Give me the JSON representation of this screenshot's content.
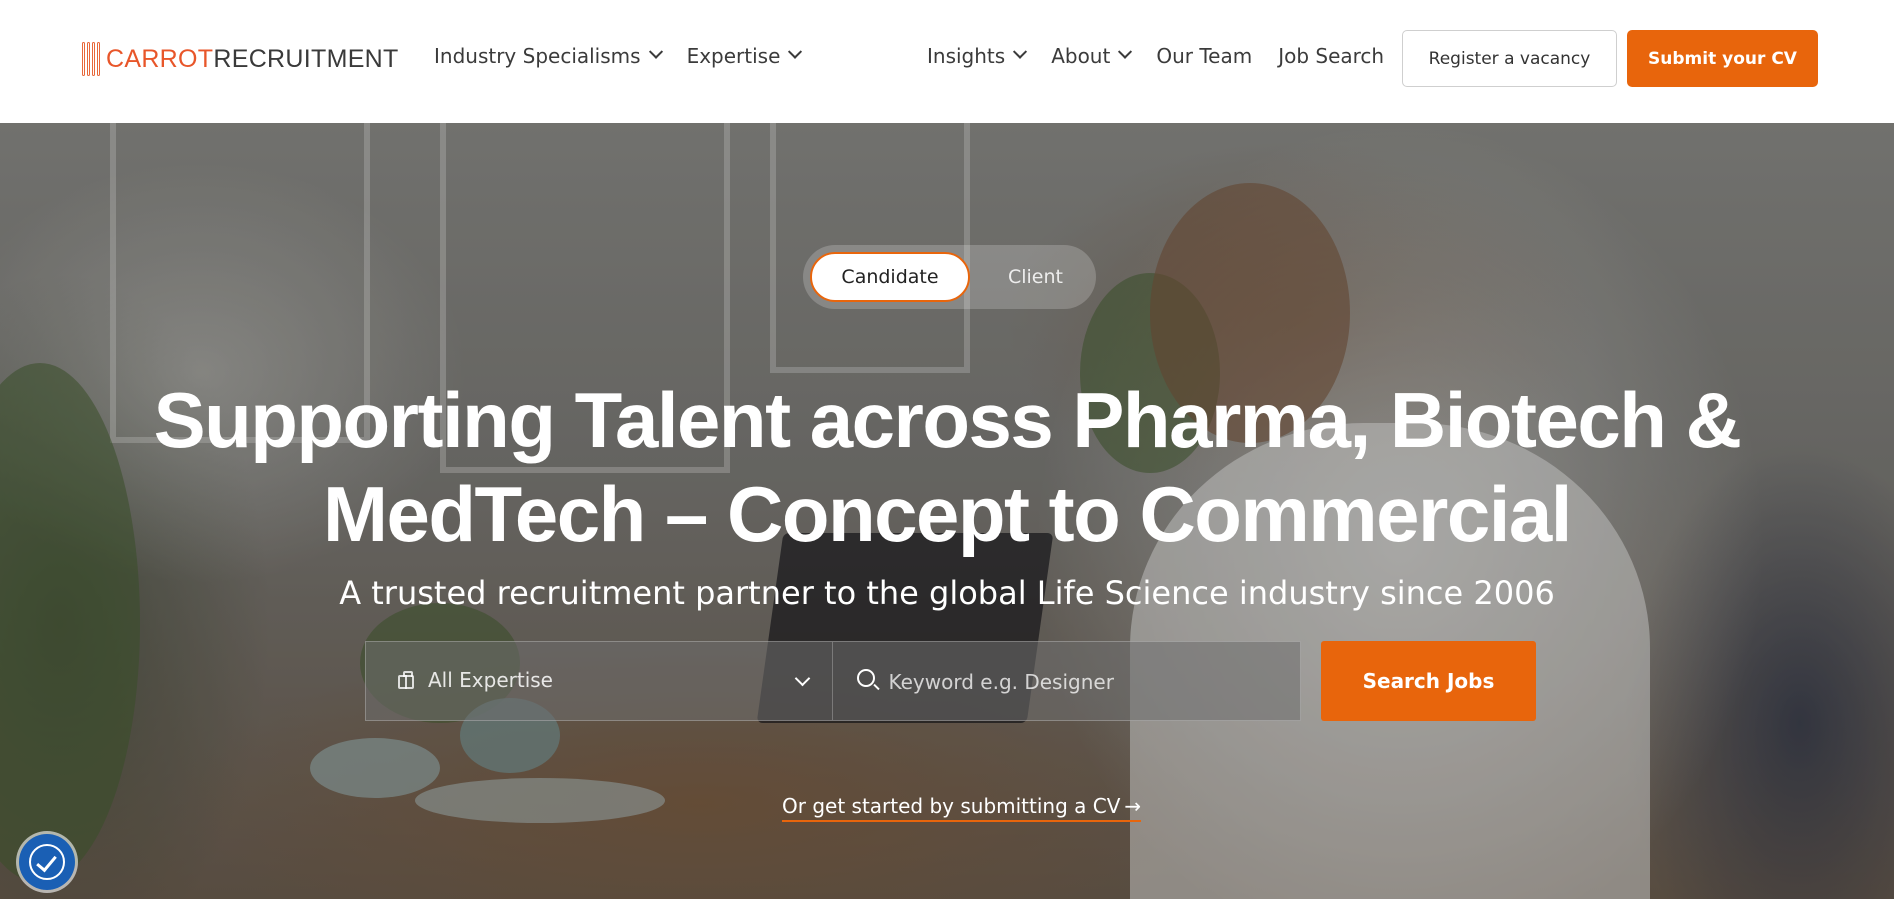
{
  "header": {
    "logo": {
      "part1": "CARROT",
      "part2": "RECRUITMENT"
    },
    "nav_left": [
      {
        "label": "Industry Specialisms",
        "has_dropdown": true
      },
      {
        "label": "Expertise",
        "has_dropdown": true
      }
    ],
    "nav_right": [
      {
        "label": "Insights",
        "has_dropdown": true
      },
      {
        "label": "About",
        "has_dropdown": true
      },
      {
        "label": "Our Team",
        "has_dropdown": false
      },
      {
        "label": "Job Search",
        "has_dropdown": false
      }
    ],
    "register_label": "Register a vacancy",
    "submit_cv_label": "Submit your CV"
  },
  "hero": {
    "toggle": {
      "active": "Candidate",
      "options": [
        "Candidate",
        "Client"
      ]
    },
    "title_line1": "Supporting Talent across Pharma, Biotech &",
    "title_line2": "MedTech – Concept to Commercial",
    "subtitle": "A trusted recruitment partner to the global Life Science industry since 2006",
    "search": {
      "expertise_value": "All Expertise",
      "keyword_placeholder": "Keyword e.g. Designer",
      "button_label": "Search Jobs"
    },
    "cv_link_label": "Or get started by submitting a CV",
    "cv_link_arrow": "→"
  },
  "icons": {
    "expertise": "briefcase-icon",
    "search": "search-icon",
    "dropdown": "chevron-down-icon",
    "accessibility": "accessibility-icon"
  },
  "colors": {
    "accent": "#e8650c",
    "logo_orange": "#e8562a",
    "text_dark": "#3b3b3b",
    "accessibility_blue": "#1a5fb4"
  }
}
